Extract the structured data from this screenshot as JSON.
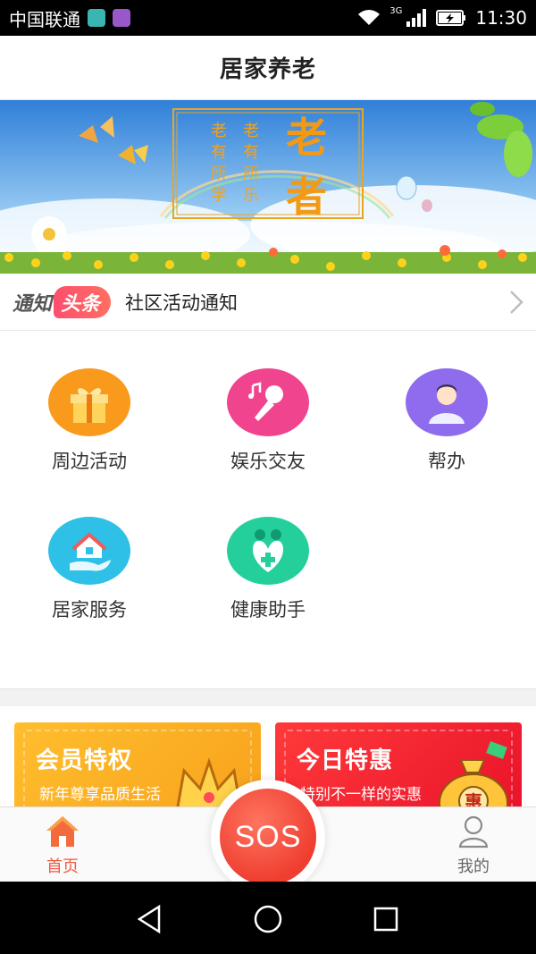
{
  "status_bar": {
    "carrier": "中国联通",
    "network": "3G",
    "time": "11:30"
  },
  "header": {
    "title": "居家养老"
  },
  "banner": {
    "couplet_left": "老有所学",
    "couplet_right": "老有所乐",
    "big_text": "老者"
  },
  "notice": {
    "badge_part1": "通知",
    "badge_part2": "头条",
    "text": "社区活动通知"
  },
  "grid": {
    "items": [
      {
        "label": "周边活动",
        "icon": "gift-icon",
        "color": "#f99a1c"
      },
      {
        "label": "娱乐交友",
        "icon": "microphone-icon",
        "color": "#f0458e"
      },
      {
        "label": "帮办",
        "icon": "person-icon",
        "color": "#8f6bee"
      },
      {
        "label": "居家服务",
        "icon": "home-service-icon",
        "color": "#2ec0e6"
      },
      {
        "label": "健康助手",
        "icon": "health-icon",
        "color": "#25cf9c"
      }
    ]
  },
  "promos": [
    {
      "title": "会员特权",
      "subtitle": "新年尊享品质生活",
      "color": "#ffb224"
    },
    {
      "title": "今日特惠",
      "subtitle": "特别不一样的实惠",
      "color": "#f2202e"
    }
  ],
  "tabbar": {
    "home_label": "首页",
    "sos_label": "SOS",
    "mine_label": "我的",
    "active_color": "#f15a40"
  }
}
